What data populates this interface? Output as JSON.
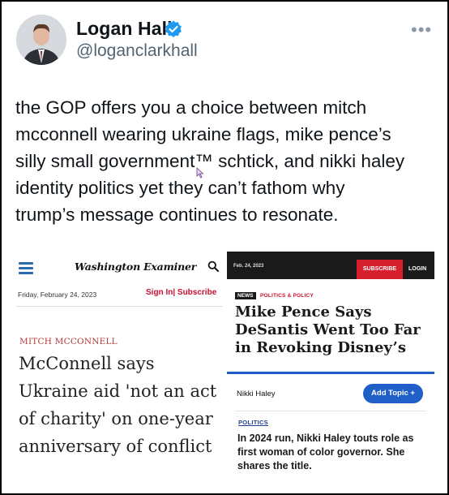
{
  "profile": {
    "name": "Logan Hall",
    "handle": "@loganclarkhall",
    "verified_icon": "verified-badge-icon",
    "more_label": "•••"
  },
  "tweet": {
    "text": "the GOP offers you a choice between mitch\nmcconnell wearing ukraine flags, mike pence’s\nsilly small government™ schtick, and nikki haley\nidentity politics yet they can’t fathom why\ntrump’s message continues to resonate."
  },
  "left_article": {
    "publication": "Washington Examiner",
    "date": "Friday, February 24, 2023",
    "signin": "Sign In| Subscribe",
    "category": "MITCH MCCONNELL",
    "headline": "McConnell says Ukraine aid 'not an act of charity' on one-year anniversary of conflict"
  },
  "right_article": {
    "date": "Feb. 24, 2023",
    "subscribe": "SUBSCRIBE",
    "login": "LOGIN",
    "news_badge": "NEWS",
    "category": "POLITICS & POLICY",
    "headline": "Mike Pence Says DeSantis Went Too Far in Revoking Disney’s Special Tax Status",
    "topic": "Nikki Haley",
    "add_topic": "Add Topic +",
    "section": "POLITICS",
    "headline2": "In 2024 run, Nikki Haley touts role as first woman of color governor. She shares the title."
  },
  "colors": {
    "verified": "#1d9bf0",
    "handle": "#536471",
    "examiner_red": "#c8102e",
    "subscribe_red": "#d51f2c",
    "topic_blue": "#1f5fc7"
  }
}
